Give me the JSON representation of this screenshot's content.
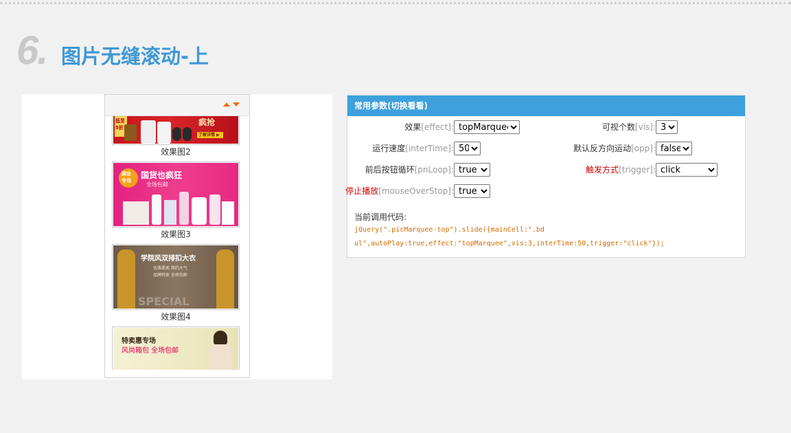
{
  "section": {
    "number": "6.",
    "title": "图片无缝滚动-上"
  },
  "marquee": {
    "items": [
      {
        "caption": "效果图2",
        "ad_lines": [
          "低至",
          "5折",
          "疯抢",
          "了解详情 ▶"
        ]
      },
      {
        "caption": "效果图3",
        "ad_lines": [
          "美妆",
          "专场",
          "国货也疯狂",
          "全场包邮"
        ]
      },
      {
        "caption": "效果图4",
        "ad_lines": [
          "学院风双排扣大衣",
          "优雅柔美 简约大气",
          "品牌特卖 全场包邮",
          "SPECIAL"
        ]
      },
      {
        "caption": "",
        "ad_lines": [
          "特卖惠专场",
          "风尚箱包 全场包邮"
        ]
      }
    ]
  },
  "params": {
    "header": "常用参数(切换看看)",
    "effect": {
      "label": "效果",
      "key": "[effect]:",
      "value": "topMarquee"
    },
    "vis": {
      "label": "可视个数",
      "key": "[vis]:",
      "value": "3"
    },
    "interTime": {
      "label": "运行速度",
      "key": "[interTime]:",
      "value": "50"
    },
    "opp": {
      "label": "默认反方向运动",
      "key": "[opp]:",
      "value": "false"
    },
    "pnLoop": {
      "label": "前后按钮循环",
      "key": "[pnLoop]:",
      "value": "true"
    },
    "trigger": {
      "label": "触发方式",
      "key": "[trigger]:",
      "value": "click"
    },
    "mouseOverStop": {
      "label": "停止播放",
      "key": "[mouseOverStop]:",
      "value": "true"
    },
    "code_label": "当前调用代码:",
    "code_line1": "jQuery(\".picMarquee-top\").slide({mainCell:\".bd",
    "code_line2": "ul\",autoPlay:true,effect:\"topMarquee\",vis:3,interTime:50,trigger:\"click\"});"
  },
  "colors": {
    "accent": "#3ca1dd",
    "title": "#3f98d6",
    "warning_label": "#d40000",
    "code": "#d46a00",
    "arrow": "#f26c00"
  }
}
